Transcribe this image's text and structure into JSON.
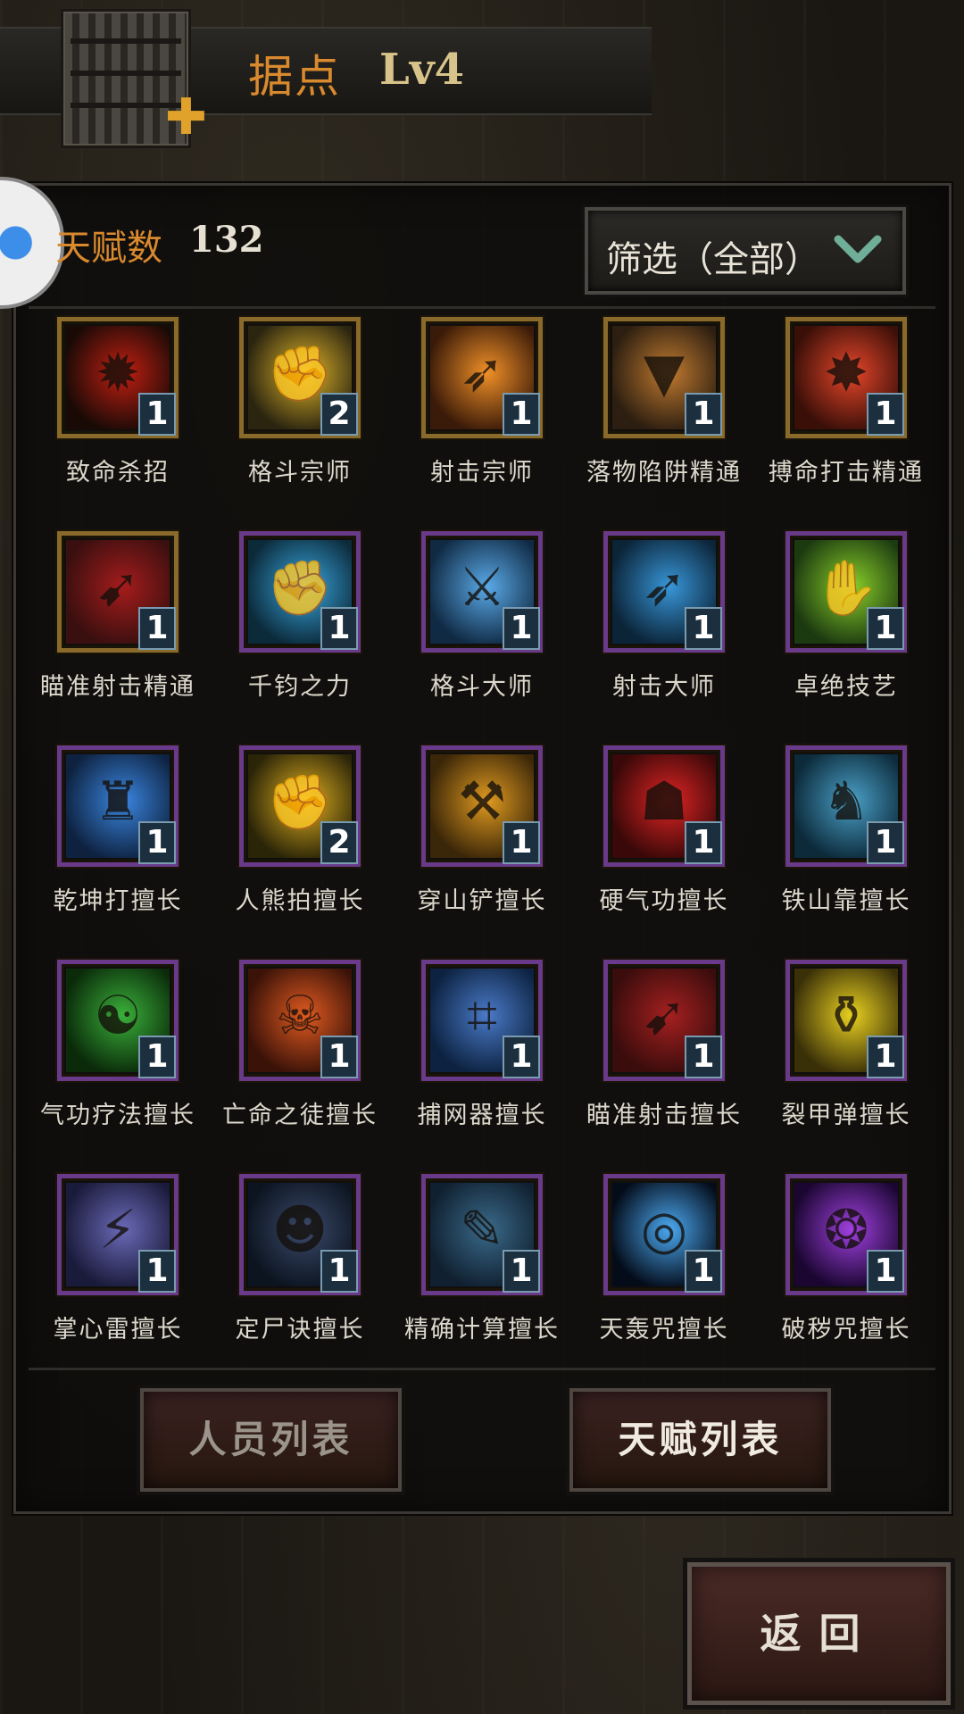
{
  "header": {
    "title": "据点",
    "level": "Lv4"
  },
  "talent": {
    "label": "天赋数",
    "count": "132"
  },
  "filter": {
    "label": "筛选（全部）"
  },
  "talents": [
    {
      "name": "致命杀招",
      "level": "1",
      "frame": "gold",
      "art": [
        "#1a0a06",
        "#c21f12"
      ],
      "glyph": "✹"
    },
    {
      "name": "格斗宗师",
      "level": "2",
      "frame": "gold",
      "art": [
        "#2b2510",
        "#e0b52a"
      ],
      "glyph": "✊"
    },
    {
      "name": "射击宗师",
      "level": "1",
      "frame": "gold",
      "art": [
        "#3a1a08",
        "#f09028"
      ],
      "glyph": "➶"
    },
    {
      "name": "落物陷阱精通",
      "level": "1",
      "frame": "gold",
      "art": [
        "#2c1e10",
        "#c07a30"
      ],
      "glyph": "▼"
    },
    {
      "name": "搏命打击精通",
      "level": "1",
      "frame": "gold",
      "art": [
        "#3a0f08",
        "#e6462a"
      ],
      "glyph": "✸"
    },
    {
      "name": "瞄准射击精通",
      "level": "1",
      "frame": "gold",
      "art": [
        "#3a0f0f",
        "#a51c1c"
      ],
      "glyph": "➹"
    },
    {
      "name": "千钧之力",
      "level": "1",
      "frame": "purple",
      "art": [
        "#0b2a3a",
        "#3aa7e0"
      ],
      "glyph": "✊"
    },
    {
      "name": "格斗大师",
      "level": "1",
      "frame": "purple",
      "art": [
        "#102a44",
        "#5aaae8"
      ],
      "glyph": "⚔"
    },
    {
      "name": "射击大师",
      "level": "1",
      "frame": "purple",
      "art": [
        "#0b2438",
        "#3896d8"
      ],
      "glyph": "➶"
    },
    {
      "name": "卓绝技艺",
      "level": "1",
      "frame": "purple",
      "art": [
        "#1c3a10",
        "#8ad02a"
      ],
      "glyph": "✋"
    },
    {
      "name": "乾坤打擅长",
      "level": "1",
      "frame": "purple",
      "art": [
        "#0e2240",
        "#3a86e0"
      ],
      "glyph": "♜"
    },
    {
      "name": "人熊拍擅长",
      "level": "2",
      "frame": "purple",
      "art": [
        "#2b2508",
        "#e0b020"
      ],
      "glyph": "✊"
    },
    {
      "name": "穿山铲擅长",
      "level": "1",
      "frame": "purple",
      "art": [
        "#3a2608",
        "#e09a20"
      ],
      "glyph": "⚒"
    },
    {
      "name": "硬气功擅长",
      "level": "1",
      "frame": "purple",
      "art": [
        "#3a0808",
        "#e02424"
      ],
      "glyph": "☗"
    },
    {
      "name": "铁山靠擅长",
      "level": "1",
      "frame": "purple",
      "art": [
        "#0c2a3a",
        "#4aa0c8"
      ],
      "glyph": "♞"
    },
    {
      "name": "气功疗法擅长",
      "level": "1",
      "frame": "purple",
      "art": [
        "#0a2a0a",
        "#3ab03a"
      ],
      "glyph": "☯"
    },
    {
      "name": "亡命之徒擅长",
      "level": "1",
      "frame": "purple",
      "art": [
        "#3a1208",
        "#e05a20"
      ],
      "glyph": "☠"
    },
    {
      "name": "捕网器擅长",
      "level": "1",
      "frame": "purple",
      "art": [
        "#0c2240",
        "#4a7ac8"
      ],
      "glyph": "⌗"
    },
    {
      "name": "瞄准射击擅长",
      "level": "1",
      "frame": "purple",
      "art": [
        "#3a0c0c",
        "#a52020"
      ],
      "glyph": "➹"
    },
    {
      "name": "裂甲弹擅长",
      "level": "1",
      "frame": "purple",
      "art": [
        "#3a3008",
        "#e8d020"
      ],
      "glyph": "⚱"
    },
    {
      "name": "掌心雷擅长",
      "level": "1",
      "frame": "purple",
      "art": [
        "#1a1a3a",
        "#6a6ab8"
      ],
      "glyph": "⚡"
    },
    {
      "name": "定尸诀擅长",
      "level": "1",
      "frame": "purple",
      "art": [
        "#0c1420",
        "#3a4a6a"
      ],
      "glyph": "☻"
    },
    {
      "name": "精确计算擅长",
      "level": "1",
      "frame": "purple",
      "art": [
        "#102030",
        "#3a6a8a"
      ],
      "glyph": "✎"
    },
    {
      "name": "天轰咒擅长",
      "level": "1",
      "frame": "purple",
      "art": [
        "#040c1a",
        "#4aa8f0"
      ],
      "glyph": "◎"
    },
    {
      "name": "破秽咒擅长",
      "level": "1",
      "frame": "purple",
      "art": [
        "#1a0630",
        "#a040e0"
      ],
      "glyph": "❂"
    }
  ],
  "buttons": {
    "personnel": "人员列表",
    "talents": "天赋列表",
    "back": "返回"
  }
}
